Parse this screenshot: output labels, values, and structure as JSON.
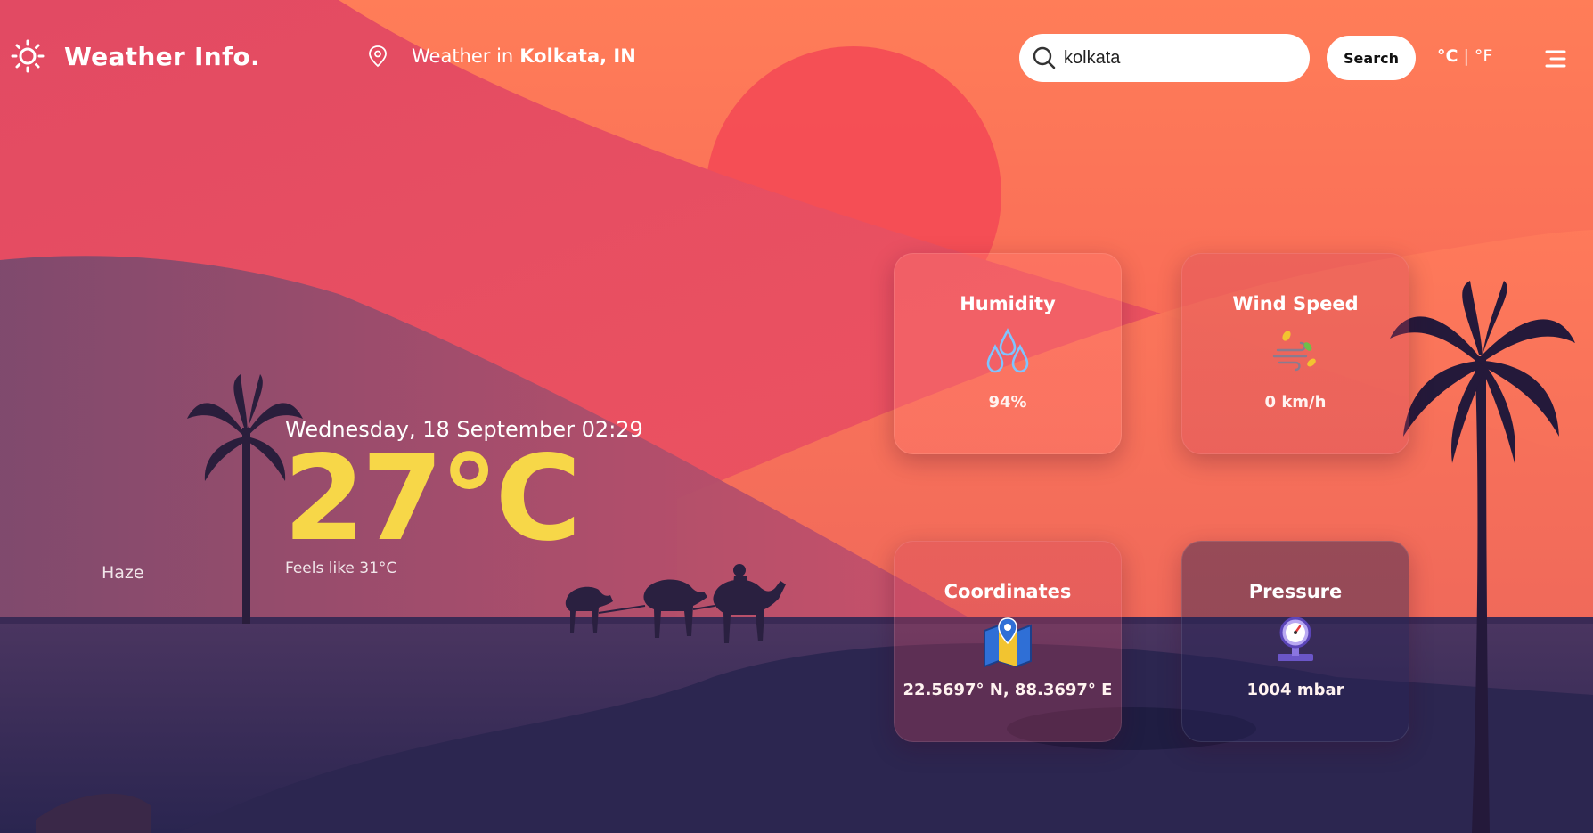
{
  "header": {
    "app_title": "Weather Info.",
    "location_prefix": "Weather in",
    "location_city": "Kolkata, IN",
    "search": {
      "value": "kolkata",
      "placeholder": ""
    },
    "search_button": "Search",
    "units": {
      "celsius": "°C",
      "separator": "|",
      "fahrenheit": "°F"
    }
  },
  "current": {
    "date_time": "Wednesday, 18 September 02:29",
    "temperature": "27°C",
    "feels_like": "Feels like 31°C",
    "condition": "Haze"
  },
  "cards": {
    "humidity": {
      "title": "Humidity",
      "value": "94%",
      "icon": "water-drops-icon"
    },
    "wind": {
      "title": "Wind Speed",
      "value": "0 km/h",
      "icon": "wind-icon"
    },
    "coordinates": {
      "title": "Coordinates",
      "value": "22.5697° N, 88.3697° E",
      "icon": "map-icon"
    },
    "pressure": {
      "title": "Pressure",
      "value": "1004 mbar",
      "icon": "pressure-gauge-icon"
    }
  },
  "colors": {
    "accent_temperature": "#f7d748",
    "text": "#ffffff"
  }
}
